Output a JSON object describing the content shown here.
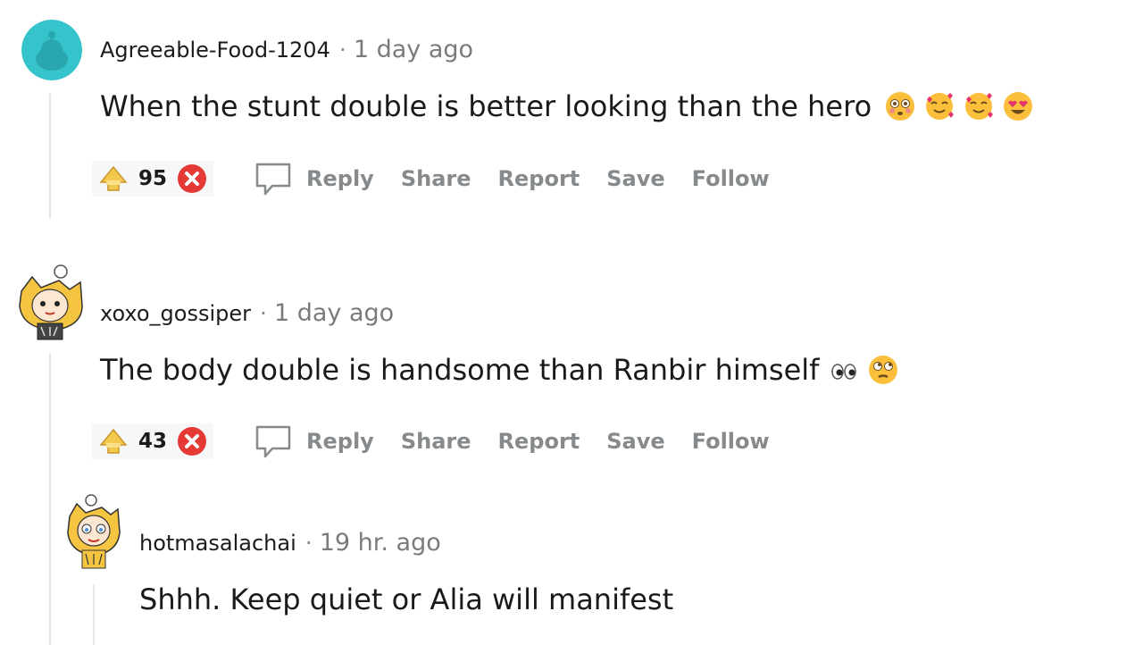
{
  "comments": [
    {
      "username": "Agreeable-Food-1204",
      "separator": "·",
      "time": "1 day ago",
      "text": "When the stunt double is better looking than the hero",
      "emojis": [
        "flushed-face-icon",
        "smiling-face-with-hearts-icon",
        "smiling-face-with-hearts-icon",
        "heart-eyes-icon"
      ],
      "votes": "95"
    },
    {
      "username": "xoxo_gossiper",
      "separator": "·",
      "time": "1 day ago",
      "text": "The body double is handsome than Ranbir himself",
      "emojis": [
        "eyes-icon",
        "face-with-rolling-eyes-icon"
      ],
      "votes": "43"
    },
    {
      "username": "hotmasalachai",
      "separator": "·",
      "time": "19 hr. ago",
      "text": "Shhh. Keep quiet or Alia will manifest"
    }
  ],
  "actions": {
    "reply": "Reply",
    "share": "Share",
    "report": "Report",
    "save": "Save",
    "follow": "Follow"
  },
  "colors": {
    "muted": "#878a8c",
    "thread_line": "#e6e6e6",
    "downvote": "#e53935",
    "upvote_award": "#f2c94c",
    "avatar_teal": "#35c4cc"
  }
}
